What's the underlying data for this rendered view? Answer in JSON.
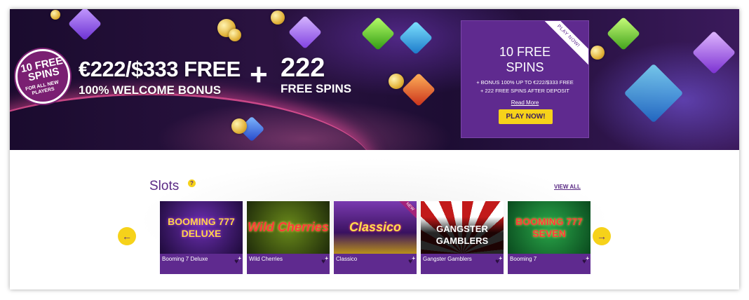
{
  "hero": {
    "badge_line1": "10 FREE SPINS",
    "badge_line2": "FOR ALL NEW PLAYERS",
    "amount": "€222/$333 FREE",
    "welcome": "100% WELCOME BONUS",
    "plus_sign": "+",
    "spins_number": "222",
    "spins_label": "FREE SPINS"
  },
  "promo": {
    "ribbon": "PLAY NOW!",
    "title_line1": "10 FREE",
    "title_line2": "SPINS",
    "info_line1": "+ BONUS 100% UP TO €222/$333 FREE",
    "info_line2": "+ 222 FREE SPINS AFTER DEPOSIT",
    "read_more": "Read More",
    "play_button": "PLAY NOW!"
  },
  "slots": {
    "title": "Slots",
    "help_icon": "?",
    "view_all": "VIEW ALL",
    "prev_arrow": "←",
    "next_arrow": "→",
    "games": [
      {
        "name": "Booming 7 Deluxe",
        "art": "BOOMING 777 DELUXE"
      },
      {
        "name": "Wild Cherries",
        "art": "Wild Cherries"
      },
      {
        "name": "Classico",
        "art": "Classico",
        "tag": "NEW"
      },
      {
        "name": "Gangster Gamblers",
        "art": "GANGSTER GAMBLERS"
      },
      {
        "name": "Booming 7",
        "art": "BOOMING 777 SEVEN"
      }
    ]
  },
  "colors": {
    "purple": "#5f2a8f",
    "yellow": "#f6d21a",
    "hero_bg": "#1a0b2e"
  }
}
